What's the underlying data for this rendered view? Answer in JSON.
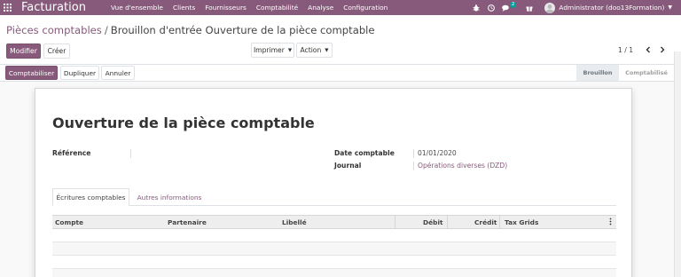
{
  "navbar": {
    "app_name": "Facturation",
    "menu": [
      "Vue d'ensemble",
      "Clients",
      "Fournisseurs",
      "Comptabilité",
      "Analyse",
      "Configuration"
    ],
    "messages_badge": "2",
    "user": "Administrator (doo13Formation)"
  },
  "breadcrumb": {
    "parent": "Pièces comptables",
    "separator": "/",
    "current": "Brouillon d'entrée Ouverture de la pièce comptable"
  },
  "buttons": {
    "edit": "Modifier",
    "create": "Créer",
    "print": "Imprimer",
    "action": "Action"
  },
  "pager": {
    "value": "1 / 1"
  },
  "statusbar": {
    "post": "Comptabiliser",
    "duplicate": "Dupliquer",
    "cancel": "Annuler",
    "stages": [
      "Brouillon",
      "Comptabilisé"
    ],
    "active_stage": "Brouillon"
  },
  "form": {
    "title": "Ouverture de la pièce comptable",
    "reference_label": "Référence",
    "reference_value": "",
    "date_label": "Date comptable",
    "date_value": "01/01/2020",
    "journal_label": "Journal",
    "journal_value": "Opérations diverses (DZD)"
  },
  "tabs": [
    "Écritures comptables",
    "Autres informations"
  ],
  "grid": {
    "columns": [
      "Compte",
      "Partenaire",
      "Libellé",
      "Débit",
      "Crédit",
      "Tax Grids"
    ]
  },
  "colors": {
    "primary": "#875a7b",
    "navbar": "#875a7b",
    "link": "#875a7b",
    "badge": "#00a09d"
  },
  "icons": {
    "app_menu": "grid-icon",
    "bug": "bug-icon",
    "activity": "clock-icon",
    "messages": "chat-icon",
    "gift": "gift-icon",
    "prev": "chevron-left-icon",
    "next": "chevron-right-icon",
    "optional_columns": "vertical-dots-icon"
  }
}
